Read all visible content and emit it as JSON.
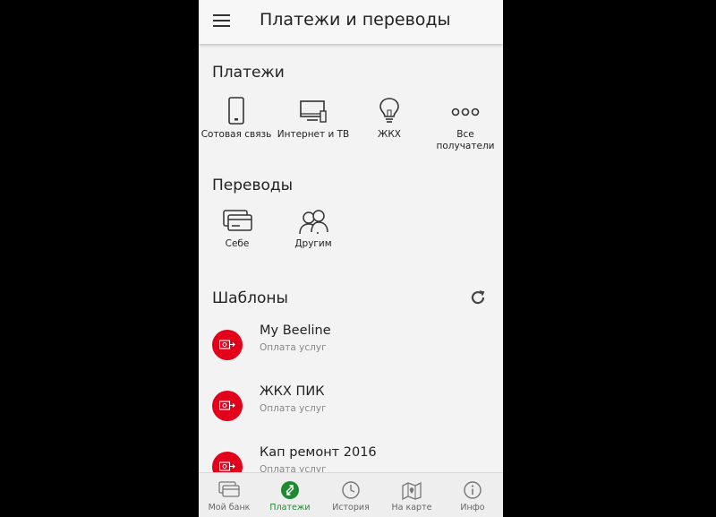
{
  "appbar": {
    "title": "Платежи и переводы",
    "menu_icon": "hamburger-menu-icon"
  },
  "payments": {
    "title": "Платежи",
    "items": [
      {
        "label": "Сотовая связь",
        "icon": "mobile-phone-icon"
      },
      {
        "label": "Интернет и ТВ",
        "icon": "tv-monitor-icon"
      },
      {
        "label": "ЖКХ",
        "icon": "light-bulb-icon"
      },
      {
        "label": "Все получатели",
        "icon": "more-dots-icon"
      }
    ]
  },
  "transfers": {
    "title": "Переводы",
    "items": [
      {
        "label": "Себе",
        "icon": "cards-icon"
      },
      {
        "label": "Другим",
        "icon": "people-icon"
      }
    ]
  },
  "templates": {
    "title": "Шаблоны",
    "refresh_icon": "refresh-icon",
    "items": [
      {
        "name": "My Beeline",
        "subtitle": "Оплата услуг",
        "icon": "payment-template-icon"
      },
      {
        "name": "ЖКХ ПИК",
        "subtitle": "Оплата услуг",
        "icon": "payment-template-icon"
      },
      {
        "name": "Кап ремонт 2016",
        "subtitle": "Оплата услуг",
        "icon": "payment-template-icon"
      }
    ]
  },
  "bottom_nav": {
    "items": [
      {
        "label": "Мой банк",
        "icon": "cards-icon",
        "active": false
      },
      {
        "label": "Платежи",
        "icon": "transfer-arrows-icon",
        "active": true
      },
      {
        "label": "История",
        "icon": "clock-icon",
        "active": false
      },
      {
        "label": "На карте",
        "icon": "map-pin-icon",
        "active": false
      },
      {
        "label": "Инфо",
        "icon": "info-icon",
        "active": false
      }
    ]
  },
  "colors": {
    "accent_red": "#e3001b",
    "active_green": "#1f8a30",
    "background": "#f3f3f3"
  }
}
